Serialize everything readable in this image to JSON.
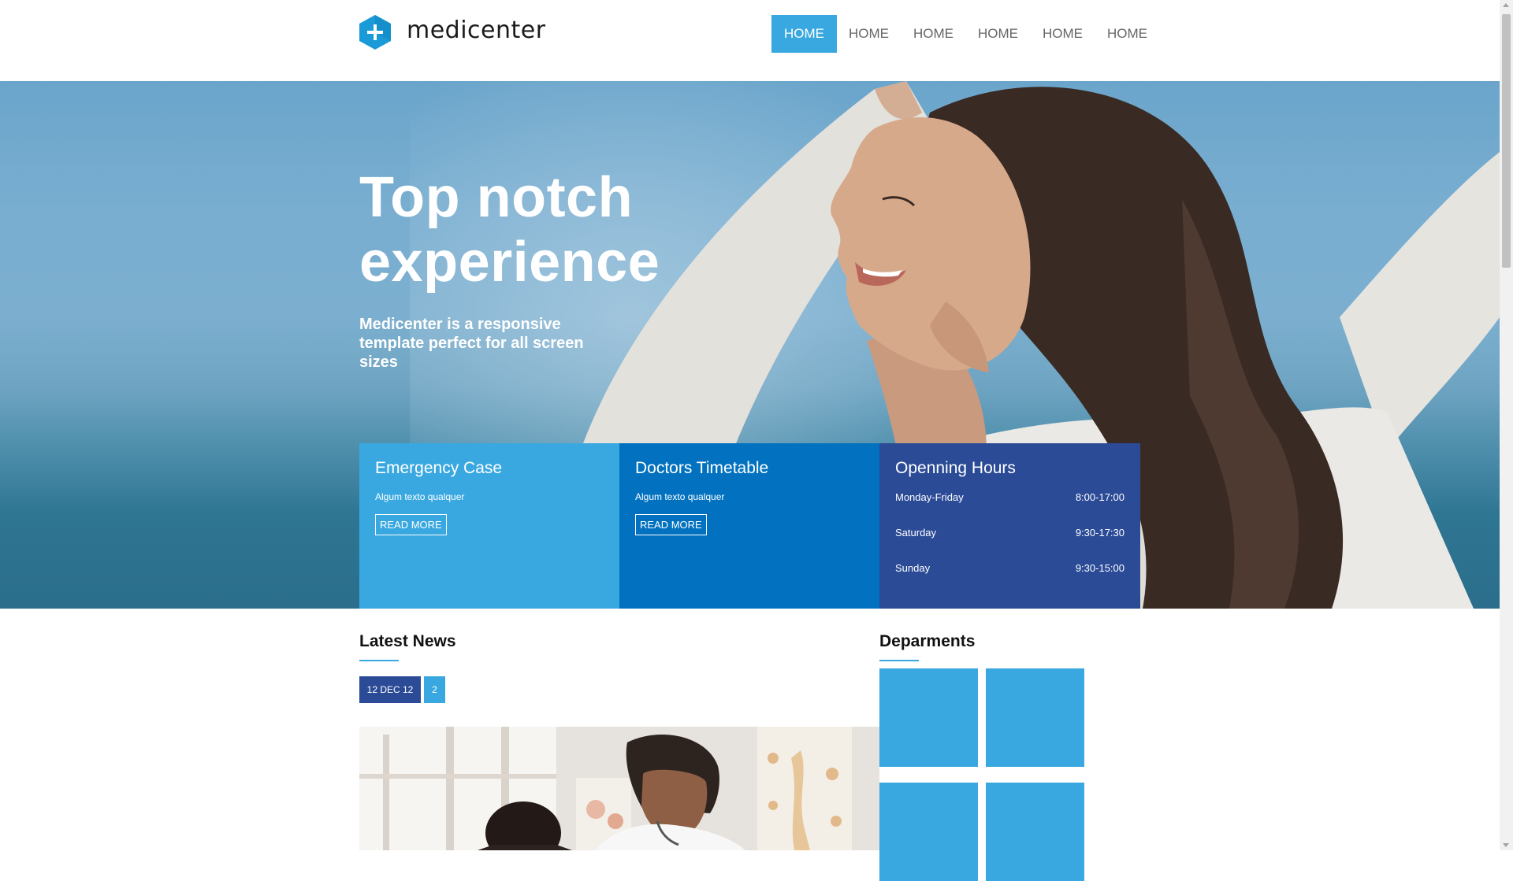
{
  "brand": {
    "name": "medicenter",
    "logo_icon": "plus-hexagon-icon",
    "accent": "#3aa8e0"
  },
  "nav": {
    "items": [
      {
        "label": "HOME",
        "active": true
      },
      {
        "label": "HOME"
      },
      {
        "label": "HOME"
      },
      {
        "label": "HOME"
      },
      {
        "label": "HOME"
      },
      {
        "label": "HOME"
      }
    ]
  },
  "hero": {
    "title": "Top notch experience",
    "subtitle": "Medicenter is a responsive template perfect for all screen sizes"
  },
  "boxes": {
    "emergency": {
      "title": "Emergency Case",
      "text": "Algum texto qualquer",
      "button": "READ MORE",
      "color": "#3aa8e0"
    },
    "timetable": {
      "title": "Doctors Timetable",
      "text": "Algum texto qualquer",
      "button": "READ MORE",
      "color": "#0272c0"
    },
    "hours": {
      "title": "Openning Hours",
      "color": "#2b4b97",
      "rows": [
        {
          "day": "Monday-Friday",
          "time": "8:00-17:00"
        },
        {
          "day": "Saturday",
          "time": "9:30-17:30"
        },
        {
          "day": "Sunday",
          "time": "9:30-15:00"
        }
      ]
    }
  },
  "news": {
    "title": "Latest News",
    "date": "12 DEC 12",
    "count": "2"
  },
  "departments": {
    "title": "Deparments",
    "tile_color": "#3aa8e0"
  }
}
